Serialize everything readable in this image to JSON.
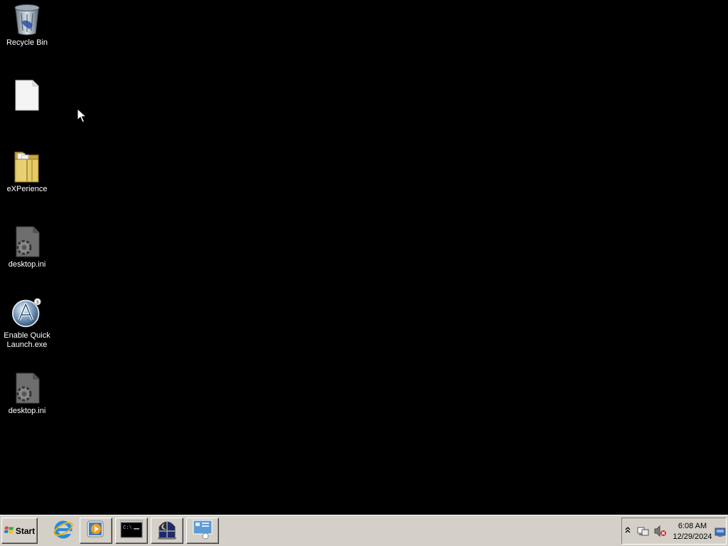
{
  "desktop": {
    "icons": [
      {
        "name": "recycle-bin",
        "label": "Recycle Bin"
      },
      {
        "name": "blank-file",
        "label": ""
      },
      {
        "name": "experience-folder",
        "label": "eXPerience"
      },
      {
        "name": "desktop-ini-1",
        "label": "desktop.ini"
      },
      {
        "name": "enable-quick-launch",
        "label": "Enable Quick Launch.exe"
      },
      {
        "name": "desktop-ini-2",
        "label": "desktop.ini"
      }
    ]
  },
  "taskbar": {
    "start_label": "Start",
    "quick_launch": [
      {
        "icon": "internet-explorer-icon"
      },
      {
        "icon": "media-player-icon"
      },
      {
        "icon": "command-prompt-icon"
      },
      {
        "icon": "moon-window-icon"
      },
      {
        "icon": "network-monitor-icon"
      }
    ],
    "tray": {
      "time": "6:08 AM",
      "date": "12/29/2024",
      "expand_glyph": "«"
    }
  },
  "colors": {
    "desktop_bg": "#000000",
    "taskbar_bg": "#d4d0c8"
  }
}
